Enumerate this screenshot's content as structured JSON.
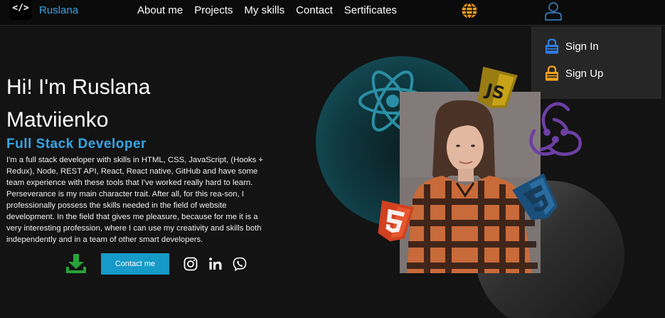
{
  "header": {
    "logo_glyph": "</>",
    "logo_text": "Ruslana",
    "nav": [
      {
        "label": "About me"
      },
      {
        "label": "Projects"
      },
      {
        "label": "My skills"
      },
      {
        "label": "Contact"
      },
      {
        "label": "Sertificates"
      }
    ],
    "globe_icon": "globe-icon",
    "user_icon": "user-icon"
  },
  "dropdown": {
    "items": [
      {
        "label": "Sign In",
        "icon": "lock-icon",
        "color": "#2f7fe6"
      },
      {
        "label": "Sign Up",
        "icon": "lock-icon",
        "color": "#f1a21c"
      }
    ]
  },
  "hero": {
    "title_line1": "Hi! I'm Ruslana",
    "title_line2": "Matviienko",
    "subtitle": "Full Stack Developer",
    "description": "I'm a full stack developer with skills in HTML, CSS, JavaScript, (Hooks + Redux), Node, REST API, React, React native, GitHub and have some team experience with these tools that I've worked really hard to learn. Perseverance is my main character trait. After all, for this rea-son, I professionally possess the skills needed in the field of website development. In the field that gives me pleasure, because for me it is a very interesting profession, where I can use my creativity and skills both independently and in a team of other smart developers.",
    "contact_button": "Contact me",
    "download_icon": "download-icon",
    "socials": [
      "instagram-icon",
      "linkedin-icon",
      "viber-icon"
    ]
  },
  "visual": {
    "tech_logos": [
      "react-icon",
      "js-logo",
      "redux-icon",
      "css3-logo",
      "html5-logo"
    ],
    "js_text": "JS",
    "photo": "profile-photo"
  },
  "colors": {
    "accent": "#35a6e6",
    "button": "#169ac7",
    "background": "#131313",
    "header": "#0b0b0b",
    "dropdown": "#262626",
    "globe": "#f39c1c",
    "download": "#27a33a"
  }
}
